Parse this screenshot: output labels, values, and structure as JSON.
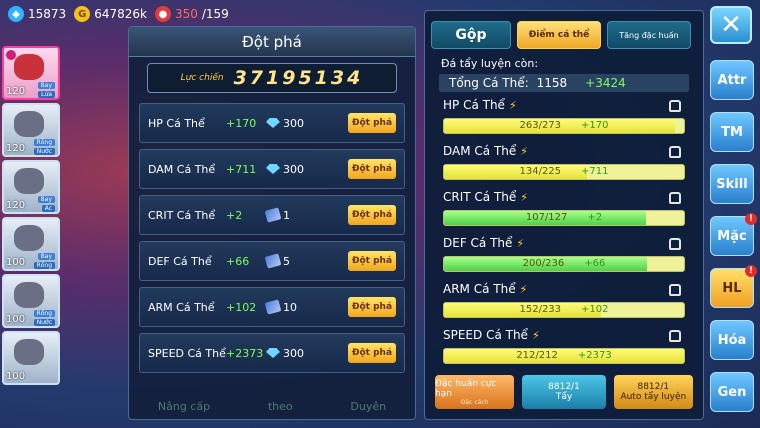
{
  "resources": {
    "gems": "15873",
    "coins": "647826k",
    "energy_current": "350",
    "energy_max": "/159"
  },
  "roster": [
    {
      "level": "120",
      "tag1": "Bay",
      "tag2": "Lửa",
      "selected": true,
      "count": "2"
    },
    {
      "level": "120",
      "tag1": "Rồng",
      "tag2": "Nước",
      "selected": false,
      "count": ""
    },
    {
      "level": "120",
      "tag1": "Bay",
      "tag2": "Ác",
      "selected": false,
      "count": ""
    },
    {
      "level": "100",
      "tag1": "Bay",
      "tag2": "Rồng",
      "selected": false,
      "count": ""
    },
    {
      "level": "100",
      "tag1": "Rồng",
      "tag2": "Nước",
      "selected": false,
      "count": ""
    },
    {
      "level": "100",
      "tag1": "",
      "tag2": "",
      "selected": false,
      "count": "3"
    }
  ],
  "breakthrough": {
    "title": "Đột phá",
    "power_label": "Lực chiến",
    "power_value": "37195134",
    "button_label": "Đột phá",
    "rows": [
      {
        "name": "HP Cá Thể",
        "bonus": "+170",
        "cost": "300",
        "cost_icon": "diamond-icon"
      },
      {
        "name": "DAM Cá Thể",
        "bonus": "+711",
        "cost": "300",
        "cost_icon": "diamond-icon"
      },
      {
        "name": "CRIT Cá Thể",
        "bonus": "+2",
        "cost": "1",
        "cost_icon": "scroll-icon"
      },
      {
        "name": "DEF Cá Thể",
        "bonus": "+66",
        "cost": "5",
        "cost_icon": "scroll-icon"
      },
      {
        "name": "ARM Cá Thể",
        "bonus": "+102",
        "cost": "10",
        "cost_icon": "scroll-icon"
      },
      {
        "name": "SPEED Cá Thể",
        "bonus": "+2373",
        "cost": "300",
        "cost_icon": "diamond-icon"
      }
    ],
    "ghost_nav": [
      "Nâng cấp",
      "theo",
      "Duyên"
    ]
  },
  "training": {
    "tabs": {
      "merge": "Gộp",
      "individual": "Điểm cá thể",
      "special": "Tăng đặc huấn"
    },
    "remaining_label": "Đá tẩy luyện còn:",
    "total_label": "Tổng Cá Thể:",
    "total_value": "1158",
    "total_bonus": "+3424",
    "stats": [
      {
        "name": "HP Cá Thể",
        "current": 263,
        "max": 273,
        "value": "263/273",
        "bonus": "+170",
        "fill_color": "yellow"
      },
      {
        "name": "DAM Cá Thể",
        "current": 134,
        "max": 225,
        "value": "134/225",
        "bonus": "+711",
        "fill_color": "yellow"
      },
      {
        "name": "CRIT Cá Thể",
        "current": 107,
        "max": 127,
        "value": "107/127",
        "bonus": "+2",
        "fill_color": "green"
      },
      {
        "name": "DEF Cá Thể",
        "current": 200,
        "max": 236,
        "value": "200/236",
        "bonus": "+66",
        "fill_color": "green"
      },
      {
        "name": "ARM Cá Thể",
        "current": 152,
        "max": 233,
        "value": "152/233",
        "bonus": "+102",
        "fill_color": "yellow"
      },
      {
        "name": "SPEED Cá Thể",
        "current": 212,
        "max": 212,
        "value": "212/212",
        "bonus": "+2373",
        "fill_color": "yellow"
      }
    ],
    "buttons": {
      "special_training": "Đặc huấn cực hạn",
      "special_training_sub": "Đặc cách",
      "wash_count": "8812/1",
      "wash_label": "Tẩy",
      "auto_wash_count": "8812/1",
      "auto_wash_label": "Auto tẩy luyện"
    }
  },
  "side_menu": [
    {
      "label": "Attr",
      "badge": false,
      "active": false
    },
    {
      "label": "TM",
      "badge": false,
      "active": false
    },
    {
      "label": "Skill",
      "badge": false,
      "active": false
    },
    {
      "label": "Mặc",
      "badge": true,
      "active": false
    },
    {
      "label": "HL",
      "badge": true,
      "active": true
    },
    {
      "label": "Hóa",
      "badge": false,
      "active": false
    },
    {
      "label": "Gen",
      "badge": false,
      "active": false
    }
  ]
}
